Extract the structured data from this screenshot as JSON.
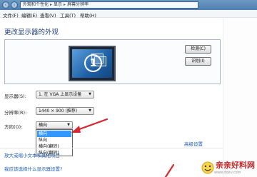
{
  "window": {
    "address_parts": [
      "外观和个性化",
      "显示",
      "屏幕分辨率"
    ]
  },
  "menubar": {
    "items": [
      "文件(F)",
      "编辑(E)",
      "查看(V)",
      "工具(T)",
      "帮助(H)"
    ]
  },
  "page": {
    "title": "更改显示器的外观"
  },
  "preview": {
    "monitor_number": "1",
    "detect_label": "检测(C)",
    "identify_label": "识别(I)"
  },
  "settings": {
    "display_label": "显示器(S):",
    "display_value": "1. 在 VGA 上显示设备",
    "resolution_label": "分辨率(R):",
    "resolution_value": "1440 × 900 (推荐)",
    "orientation_label": "方向(O):",
    "orientation_value": "横向",
    "orientation_options": [
      "横向",
      "纵向",
      "横向(翻转)",
      "纵向(翻转)"
    ],
    "selected_option_index": 0,
    "advanced_link": "高级设置"
  },
  "links": {
    "text_size": "放大或缩小文本和其他项目",
    "help": "我应该选择什么显示器设置?"
  },
  "watermark": {
    "name": "亲亲好料网",
    "url": "www.ddxv.com"
  },
  "colors": {
    "accent": "#3399ff",
    "link": "#1a5bb5",
    "title": "#1e3f78",
    "annotation_arrow": "#d9282f"
  }
}
